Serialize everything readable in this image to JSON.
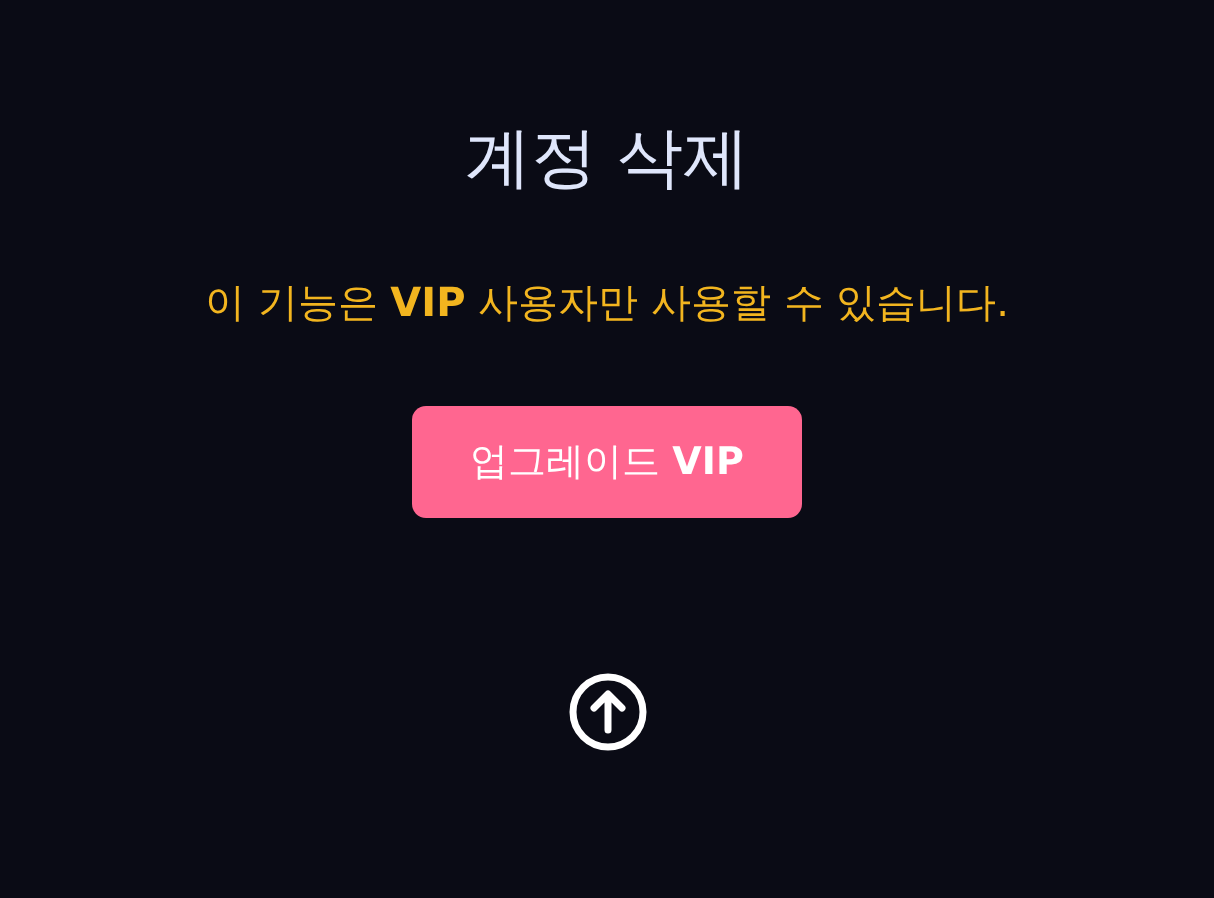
{
  "title": "계정 삭제",
  "message": "이 기능은 **VIP** 사용자만 사용할 수 있습니다.",
  "upgrade_button": {
    "label": "업그레이드 **VIP**"
  }
}
